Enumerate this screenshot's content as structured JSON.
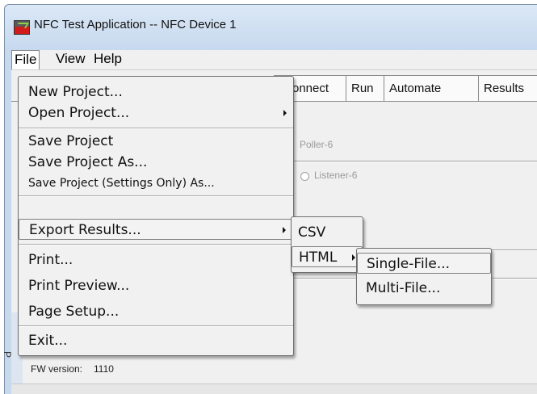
{
  "window": {
    "title": "NFC Test Application -- NFC Device 1",
    "icon": "app-icon"
  },
  "menubar": {
    "file": "File",
    "view": "View",
    "help": "Help"
  },
  "tabs": {
    "connect": "onnect",
    "run": "Run",
    "automate": "Automate",
    "results": "Results"
  },
  "panel": {
    "poller_label": "Poller-6",
    "listener_label": "Listener-6",
    "fw_label": "FW version:",
    "fw_value": "1110",
    "side_strip_text": "P"
  },
  "file_menu": {
    "items": [
      {
        "label": "New Project..."
      },
      {
        "label": "Open Project...",
        "has_submenu": true
      },
      {
        "label": "Save Project"
      },
      {
        "label": "Save Project As..."
      },
      {
        "label": "Save Project (Settings Only) As..."
      },
      {
        "label": "Export Results...",
        "has_submenu": true,
        "highlighted": true
      },
      {
        "label": "Print..."
      },
      {
        "label": "Print Preview..."
      },
      {
        "label": "Page Setup..."
      },
      {
        "label": "Exit..."
      }
    ]
  },
  "export_submenu": {
    "items": [
      {
        "label": "CSV"
      },
      {
        "label": "HTML",
        "has_submenu": true,
        "highlighted": true
      }
    ]
  },
  "html_submenu": {
    "items": [
      {
        "label": "Single-File...",
        "highlighted": true
      },
      {
        "label": "Multi-File..."
      }
    ]
  },
  "colors": {
    "title_bar": "#c8d9ec",
    "menu_bg": "#f1f1f1",
    "panel_bg": "#f0f0f0"
  }
}
